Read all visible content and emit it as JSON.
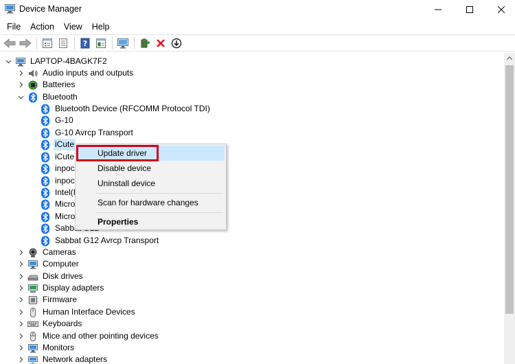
{
  "window": {
    "title": "Device Manager"
  },
  "menu": [
    "File",
    "Action",
    "View",
    "Help"
  ],
  "toolbar": {
    "icons": [
      "back-arrow-icon",
      "forward-arrow-icon",
      "tree-view-icon",
      "properties-icon",
      "help-icon",
      "details-pane-icon",
      "scan-monitor-icon",
      "add-driver-icon",
      "uninstall-x-icon",
      "update-download-icon"
    ]
  },
  "tree": {
    "root": "LAPTOP-4BAGK7F2",
    "items": [
      {
        "label": "Audio inputs and outputs",
        "icon": "speaker-icon",
        "level": 1,
        "state": "collapsed"
      },
      {
        "label": "Batteries",
        "icon": "battery-icon",
        "level": 1,
        "state": "collapsed"
      },
      {
        "label": "Bluetooth",
        "icon": "bluetooth-icon",
        "level": 1,
        "state": "expanded"
      },
      {
        "label": "Bluetooth Device (RFCOMM Protocol TDI)",
        "icon": "bluetooth-icon",
        "level": 2
      },
      {
        "label": "G-10",
        "icon": "bluetooth-icon",
        "level": 2
      },
      {
        "label": "G-10 Avrcp Transport",
        "icon": "bluetooth-icon",
        "level": 2
      },
      {
        "label": "iCute",
        "icon": "bluetooth-icon",
        "level": 2,
        "selected": true
      },
      {
        "label": "iCute",
        "icon": "bluetooth-icon",
        "level": 2
      },
      {
        "label": "inpoc",
        "icon": "bluetooth-icon",
        "level": 2
      },
      {
        "label": "inpoc",
        "icon": "bluetooth-icon",
        "level": 2
      },
      {
        "label": "Intel(I",
        "icon": "bluetooth-icon",
        "level": 2
      },
      {
        "label": "Micro",
        "icon": "bluetooth-icon",
        "level": 2
      },
      {
        "label": "Micro",
        "icon": "bluetooth-icon",
        "level": 2
      },
      {
        "label": "Sabbat G12",
        "icon": "bluetooth-icon",
        "level": 2
      },
      {
        "label": "Sabbat G12 Avrcp Transport",
        "icon": "bluetooth-icon",
        "level": 2
      },
      {
        "label": "Cameras",
        "icon": "camera-icon",
        "level": 1,
        "state": "collapsed"
      },
      {
        "label": "Computer",
        "icon": "computer-icon",
        "level": 1,
        "state": "collapsed"
      },
      {
        "label": "Disk drives",
        "icon": "disk-drive-icon",
        "level": 1,
        "state": "collapsed"
      },
      {
        "label": "Display adapters",
        "icon": "display-adapter-icon",
        "level": 1,
        "state": "collapsed"
      },
      {
        "label": "Firmware",
        "icon": "firmware-icon",
        "level": 1,
        "state": "collapsed"
      },
      {
        "label": "Human Interface Devices",
        "icon": "hid-icon",
        "level": 1,
        "state": "collapsed"
      },
      {
        "label": "Keyboards",
        "icon": "keyboard-icon",
        "level": 1,
        "state": "collapsed"
      },
      {
        "label": "Mice and other pointing devices",
        "icon": "mouse-icon",
        "level": 1,
        "state": "collapsed"
      },
      {
        "label": "Monitors",
        "icon": "monitor-icon",
        "level": 1,
        "state": "collapsed"
      },
      {
        "label": "Network adapters",
        "icon": "network-adapter-icon",
        "level": 1,
        "state": "collapsed"
      }
    ]
  },
  "context_menu": {
    "items": [
      {
        "label": "Update driver",
        "highlighted": true
      },
      {
        "label": "Disable device"
      },
      {
        "label": "Uninstall device"
      },
      {
        "label": "Scan for hardware changes"
      },
      {
        "label": "Properties",
        "bold": true
      }
    ]
  },
  "colors": {
    "selection": "#cce8ff",
    "bluetooth": "#1a73e8",
    "highlight_border": "#d0021b"
  }
}
